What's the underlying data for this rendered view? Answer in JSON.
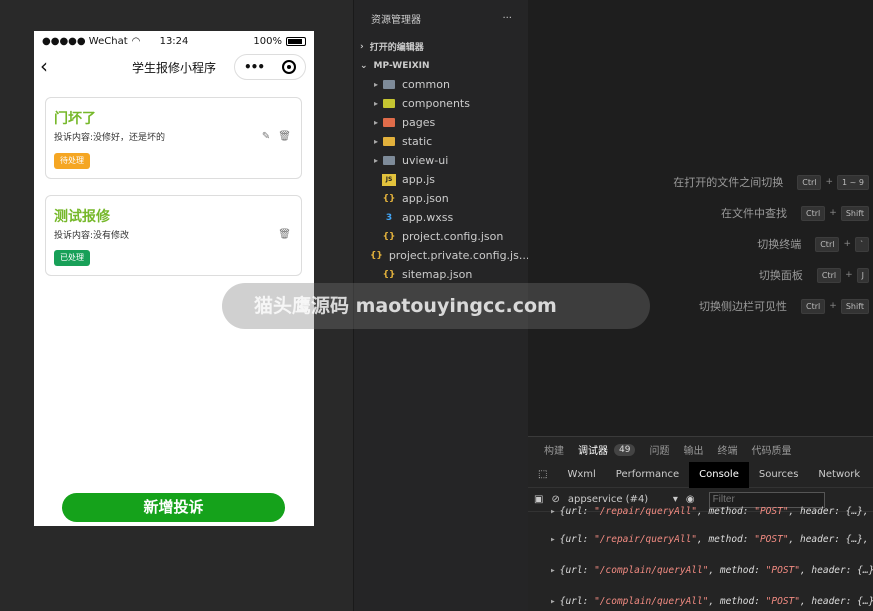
{
  "phone": {
    "status": {
      "carrier": "●●●●● WeChat",
      "wifi": "wifi",
      "time": "13:24",
      "battery_pct": "100%"
    },
    "nav_title": "学生报修小程序",
    "back_glyph": "‹",
    "capsule_dots": "•••",
    "cards": [
      {
        "title": "门坏了",
        "content": "投诉内容:没修好，还是坏的",
        "status": "待处理"
      },
      {
        "title": "测试报修",
        "content": "投诉内容:没有修改",
        "status": "已处理"
      }
    ],
    "add_button": "新增投诉"
  },
  "explorer": {
    "title": "资源管理器",
    "more": "···",
    "open_editors": "打开的编辑器",
    "project": "MP-WEIXIN",
    "items": [
      {
        "name": "common",
        "kind": "folder",
        "color": "#7e8b99"
      },
      {
        "name": "components",
        "kind": "folder",
        "color": "#c5c531"
      },
      {
        "name": "pages",
        "kind": "folder",
        "color": "#e06c4a"
      },
      {
        "name": "static",
        "kind": "folder",
        "color": "#e2b13c"
      },
      {
        "name": "uview-ui",
        "kind": "folder",
        "color": "#7e8b99"
      },
      {
        "name": "app.js",
        "kind": "js",
        "color": "#e2c23c"
      },
      {
        "name": "app.json",
        "kind": "json",
        "color": "#e2b13c"
      },
      {
        "name": "app.wxss",
        "kind": "css",
        "color": "#42a5f5"
      },
      {
        "name": "project.config.json",
        "kind": "json",
        "color": "#e2b13c"
      },
      {
        "name": "project.private.config.js...",
        "kind": "json",
        "color": "#e2b13c"
      },
      {
        "name": "sitemap.json",
        "kind": "json",
        "color": "#e2b13c"
      }
    ]
  },
  "shortcuts": [
    {
      "label": "在打开的文件之间切换",
      "keys": [
        "Ctrl",
        "1 ~ 9"
      ]
    },
    {
      "label": "在文件中查找",
      "keys": [
        "Ctrl",
        "Shift"
      ]
    },
    {
      "label": "切换终端",
      "keys": [
        "Ctrl",
        "`"
      ]
    },
    {
      "label": "切换面板",
      "keys": [
        "Ctrl",
        "J"
      ]
    },
    {
      "label": "切换侧边栏可见性",
      "keys": [
        "Ctrl",
        "Shift"
      ]
    }
  ],
  "devtools": {
    "tabs": [
      "构建",
      "调试器",
      "问题",
      "输出",
      "终端",
      "代码质量"
    ],
    "active_tab": "调试器",
    "badge": "49",
    "subtabs": [
      "Wxml",
      "Performance",
      "Console",
      "Sources",
      "Network"
    ],
    "active_subtab": "Console",
    "context": "appservice (#4)",
    "filter_placeholder": "Filter",
    "logs": [
      {
        "url": "\"/repair/queryAll\"",
        "method": "\"POST\""
      },
      {
        "url": "\"/repair/queryAll\"",
        "method": "\"POST\""
      },
      {
        "url": "\"/complain/queryAll\"",
        "method": "\"POST\""
      },
      {
        "url": "\"/complain/queryAll\"",
        "method": "\"POST\""
      }
    ]
  },
  "watermark": "猫头鹰源码 maotouyingcc.com",
  "colors": {
    "accent_green": "#15a21b",
    "title_green": "#76b82a",
    "pending": "#f5a623",
    "done": "#18a058"
  }
}
